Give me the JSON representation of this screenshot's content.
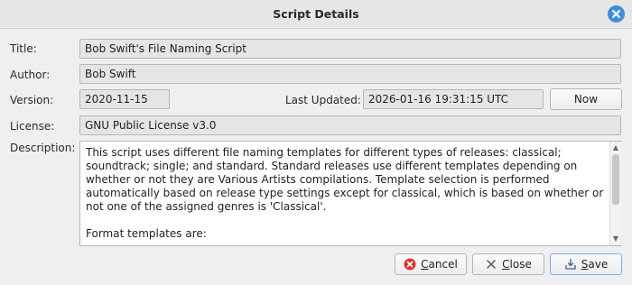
{
  "window": {
    "title": "Script Details",
    "close_icon": "close-icon"
  },
  "form": {
    "title_label": "Title:",
    "title_value": "Bob Swift's File Naming Script",
    "author_label": "Author:",
    "author_value": "Bob Swift",
    "version_label": "Version:",
    "version_value": "2020-11-15",
    "last_updated_label": "Last Updated:",
    "last_updated_value": "2026-01-16 19:31:15 UTC",
    "now_button": "Now",
    "license_label": "License:",
    "license_value": "GNU Public License v3.0",
    "description_label": "Description:",
    "description_value": "This script uses different file naming templates for different types of releases: classical;\nsoundtrack; single; and standard. Standard releases use different templates depending on\nwhether or not they are Various Artists compilations. Template selection is performed\nautomatically based on release type settings except for classical, which is based on whether or\nnot one of the assigned genres is 'Classical'.\n\nFormat templates are:"
  },
  "buttons": {
    "cancel_accel": "C",
    "cancel_rest": "ancel",
    "close_accel": "C",
    "close_rest": "lose",
    "save_accel": "S",
    "save_rest": "ave"
  },
  "colors": {
    "accent": "#3d8fdc",
    "cancel_icon": "#d9362f"
  }
}
